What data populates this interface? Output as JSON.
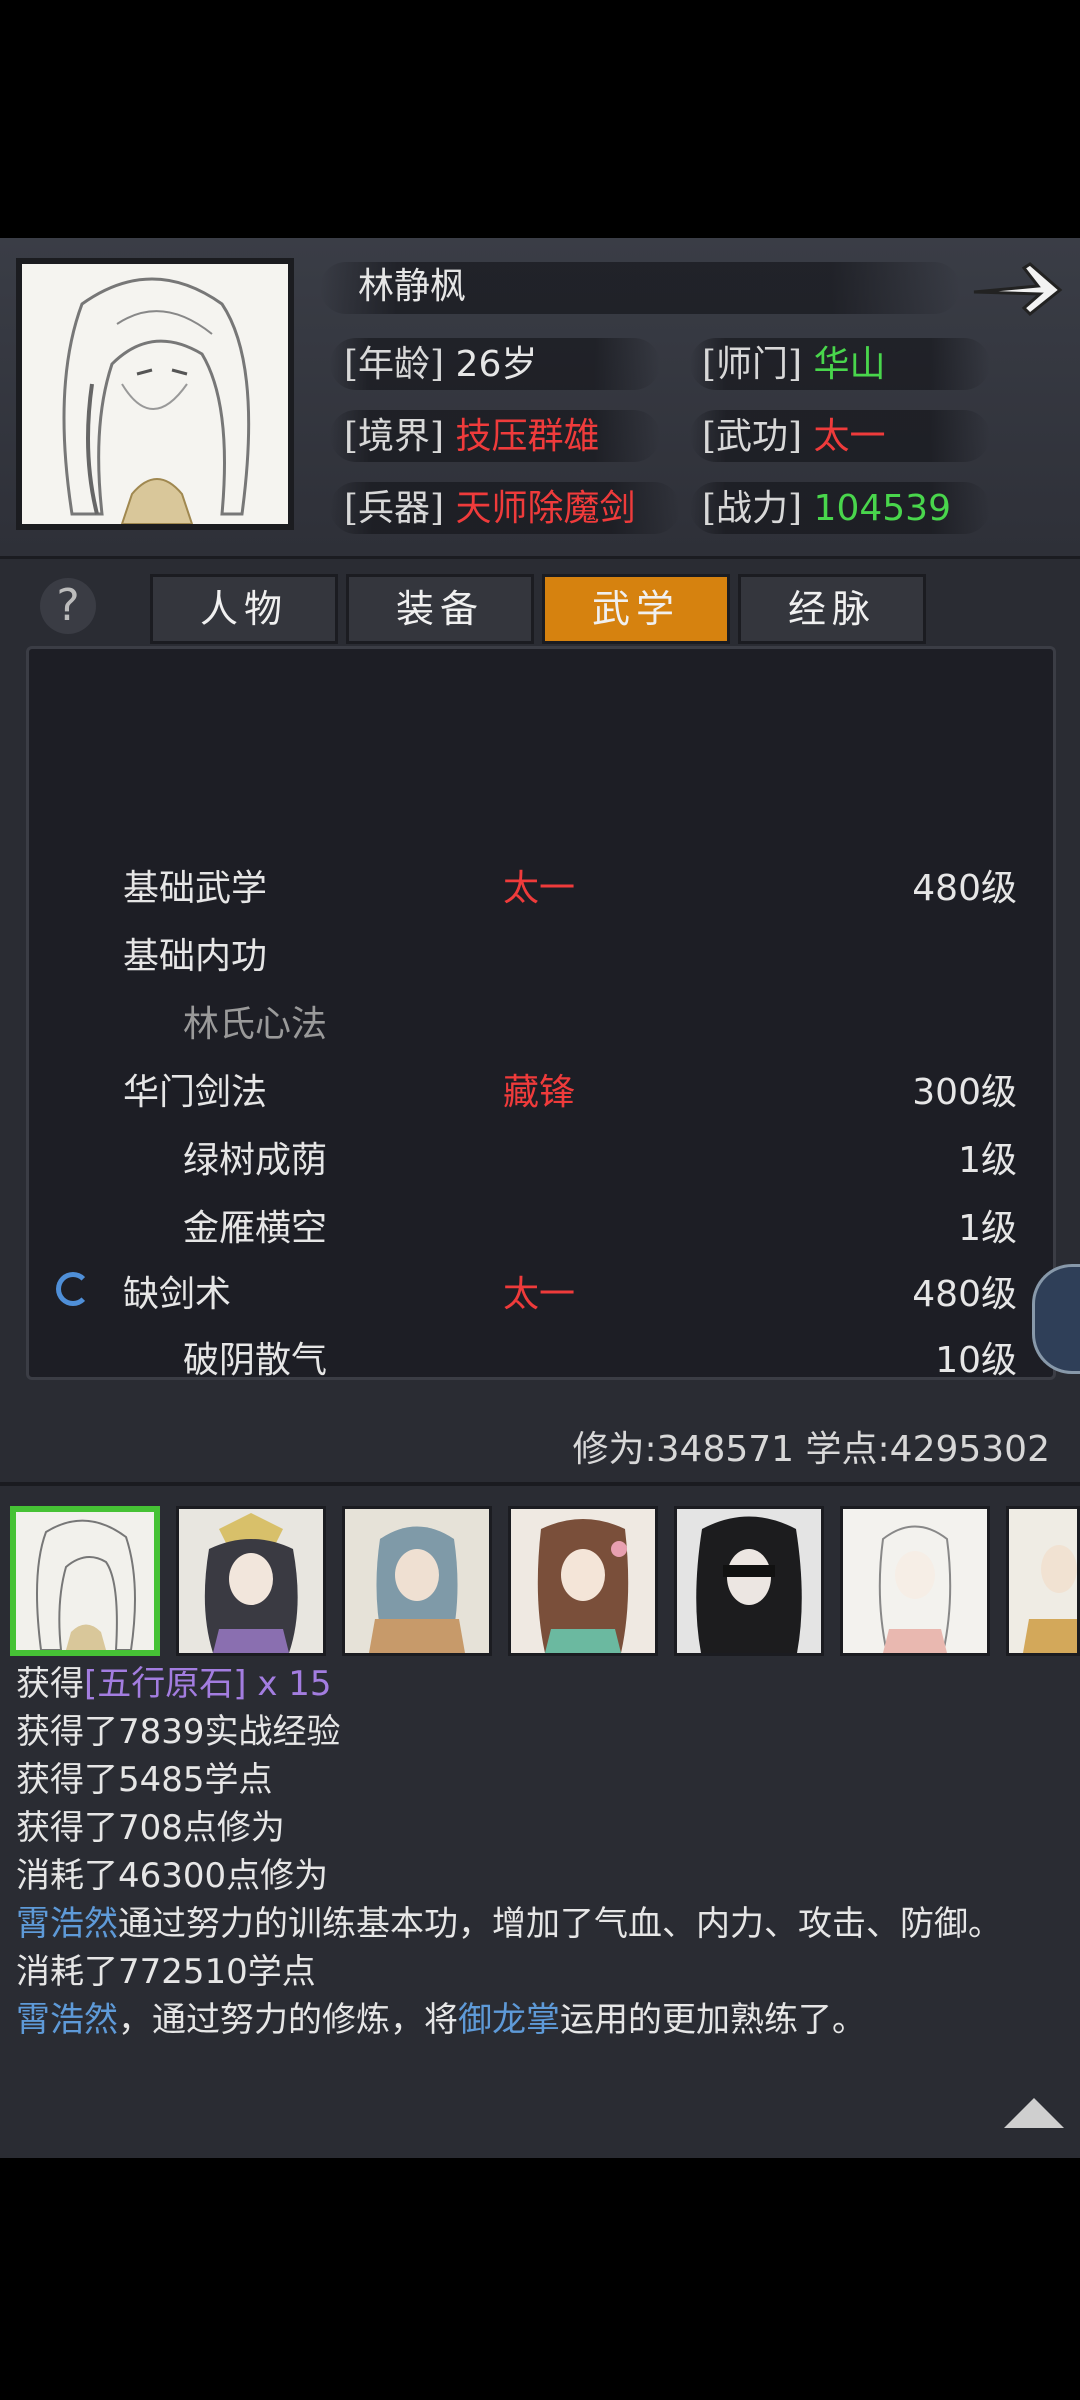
{
  "character": {
    "name": "林静枫",
    "age_label": "[年龄]",
    "age_value": "26岁",
    "sect_label": "[师门]",
    "sect_value": "华山",
    "realm_label": "[境界]",
    "realm_value": "技压群雄",
    "martial_label": "[武功]",
    "martial_value": "太一",
    "weapon_label": "[兵器]",
    "weapon_value": "天师除魔剑",
    "power_label": "[战力]",
    "power_value": "104539"
  },
  "help_icon": "?",
  "tabs": [
    {
      "label": "人物"
    },
    {
      "label": "装备"
    },
    {
      "label": "武学",
      "active": true
    },
    {
      "label": "经脉"
    }
  ],
  "skills": [
    {
      "name": "基础武学",
      "style": "太一",
      "level": "480级"
    },
    {
      "name": "基础内功",
      "style": "",
      "level": ""
    },
    {
      "name": "林氏心法",
      "style": "",
      "level": ""
    },
    {
      "name": "华门剑法",
      "style": "藏锋",
      "level": "300级"
    },
    {
      "name": "绿树成荫",
      "style": "",
      "level": "1级"
    },
    {
      "name": "金雁横空",
      "style": "",
      "level": "1级"
    },
    {
      "name": "缺剑术",
      "style": "太一",
      "level": "480级"
    },
    {
      "name": "破阴散气",
      "style": "",
      "level": "10级"
    }
  ],
  "stats": {
    "cultivation": "修为:348571",
    "study_points": "学点:4295302"
  },
  "log": {
    "line1_prefix": "获得",
    "line1_item": "[五行原石] x 15",
    "line2": "获得了7839实战经验",
    "line3": "获得了5485学点",
    "line4": "获得了708点修为",
    "line5": "消耗了46300点修为",
    "line6_name": "霄浩然",
    "line6_text": "通过努力的训练基本功，增加了气血、内力、攻击、防御。",
    "line7": "消耗了772510学点",
    "line8_name": "霄浩然",
    "line8_mid": "，通过努力的修炼，将",
    "line8_skill": "御龙掌",
    "line8_end": "运用的更加熟练了。"
  },
  "colors": {
    "highlight_red": "#ef3b3b",
    "highlight_green": "#49d64c",
    "active_tab": "#d6820f",
    "name_blue": "#5e9ad8",
    "item_purple": "#a37de0"
  },
  "icons": [
    "arrow-right-icon",
    "question-icon",
    "loading-spinner-icon",
    "scroll-up-icon"
  ]
}
